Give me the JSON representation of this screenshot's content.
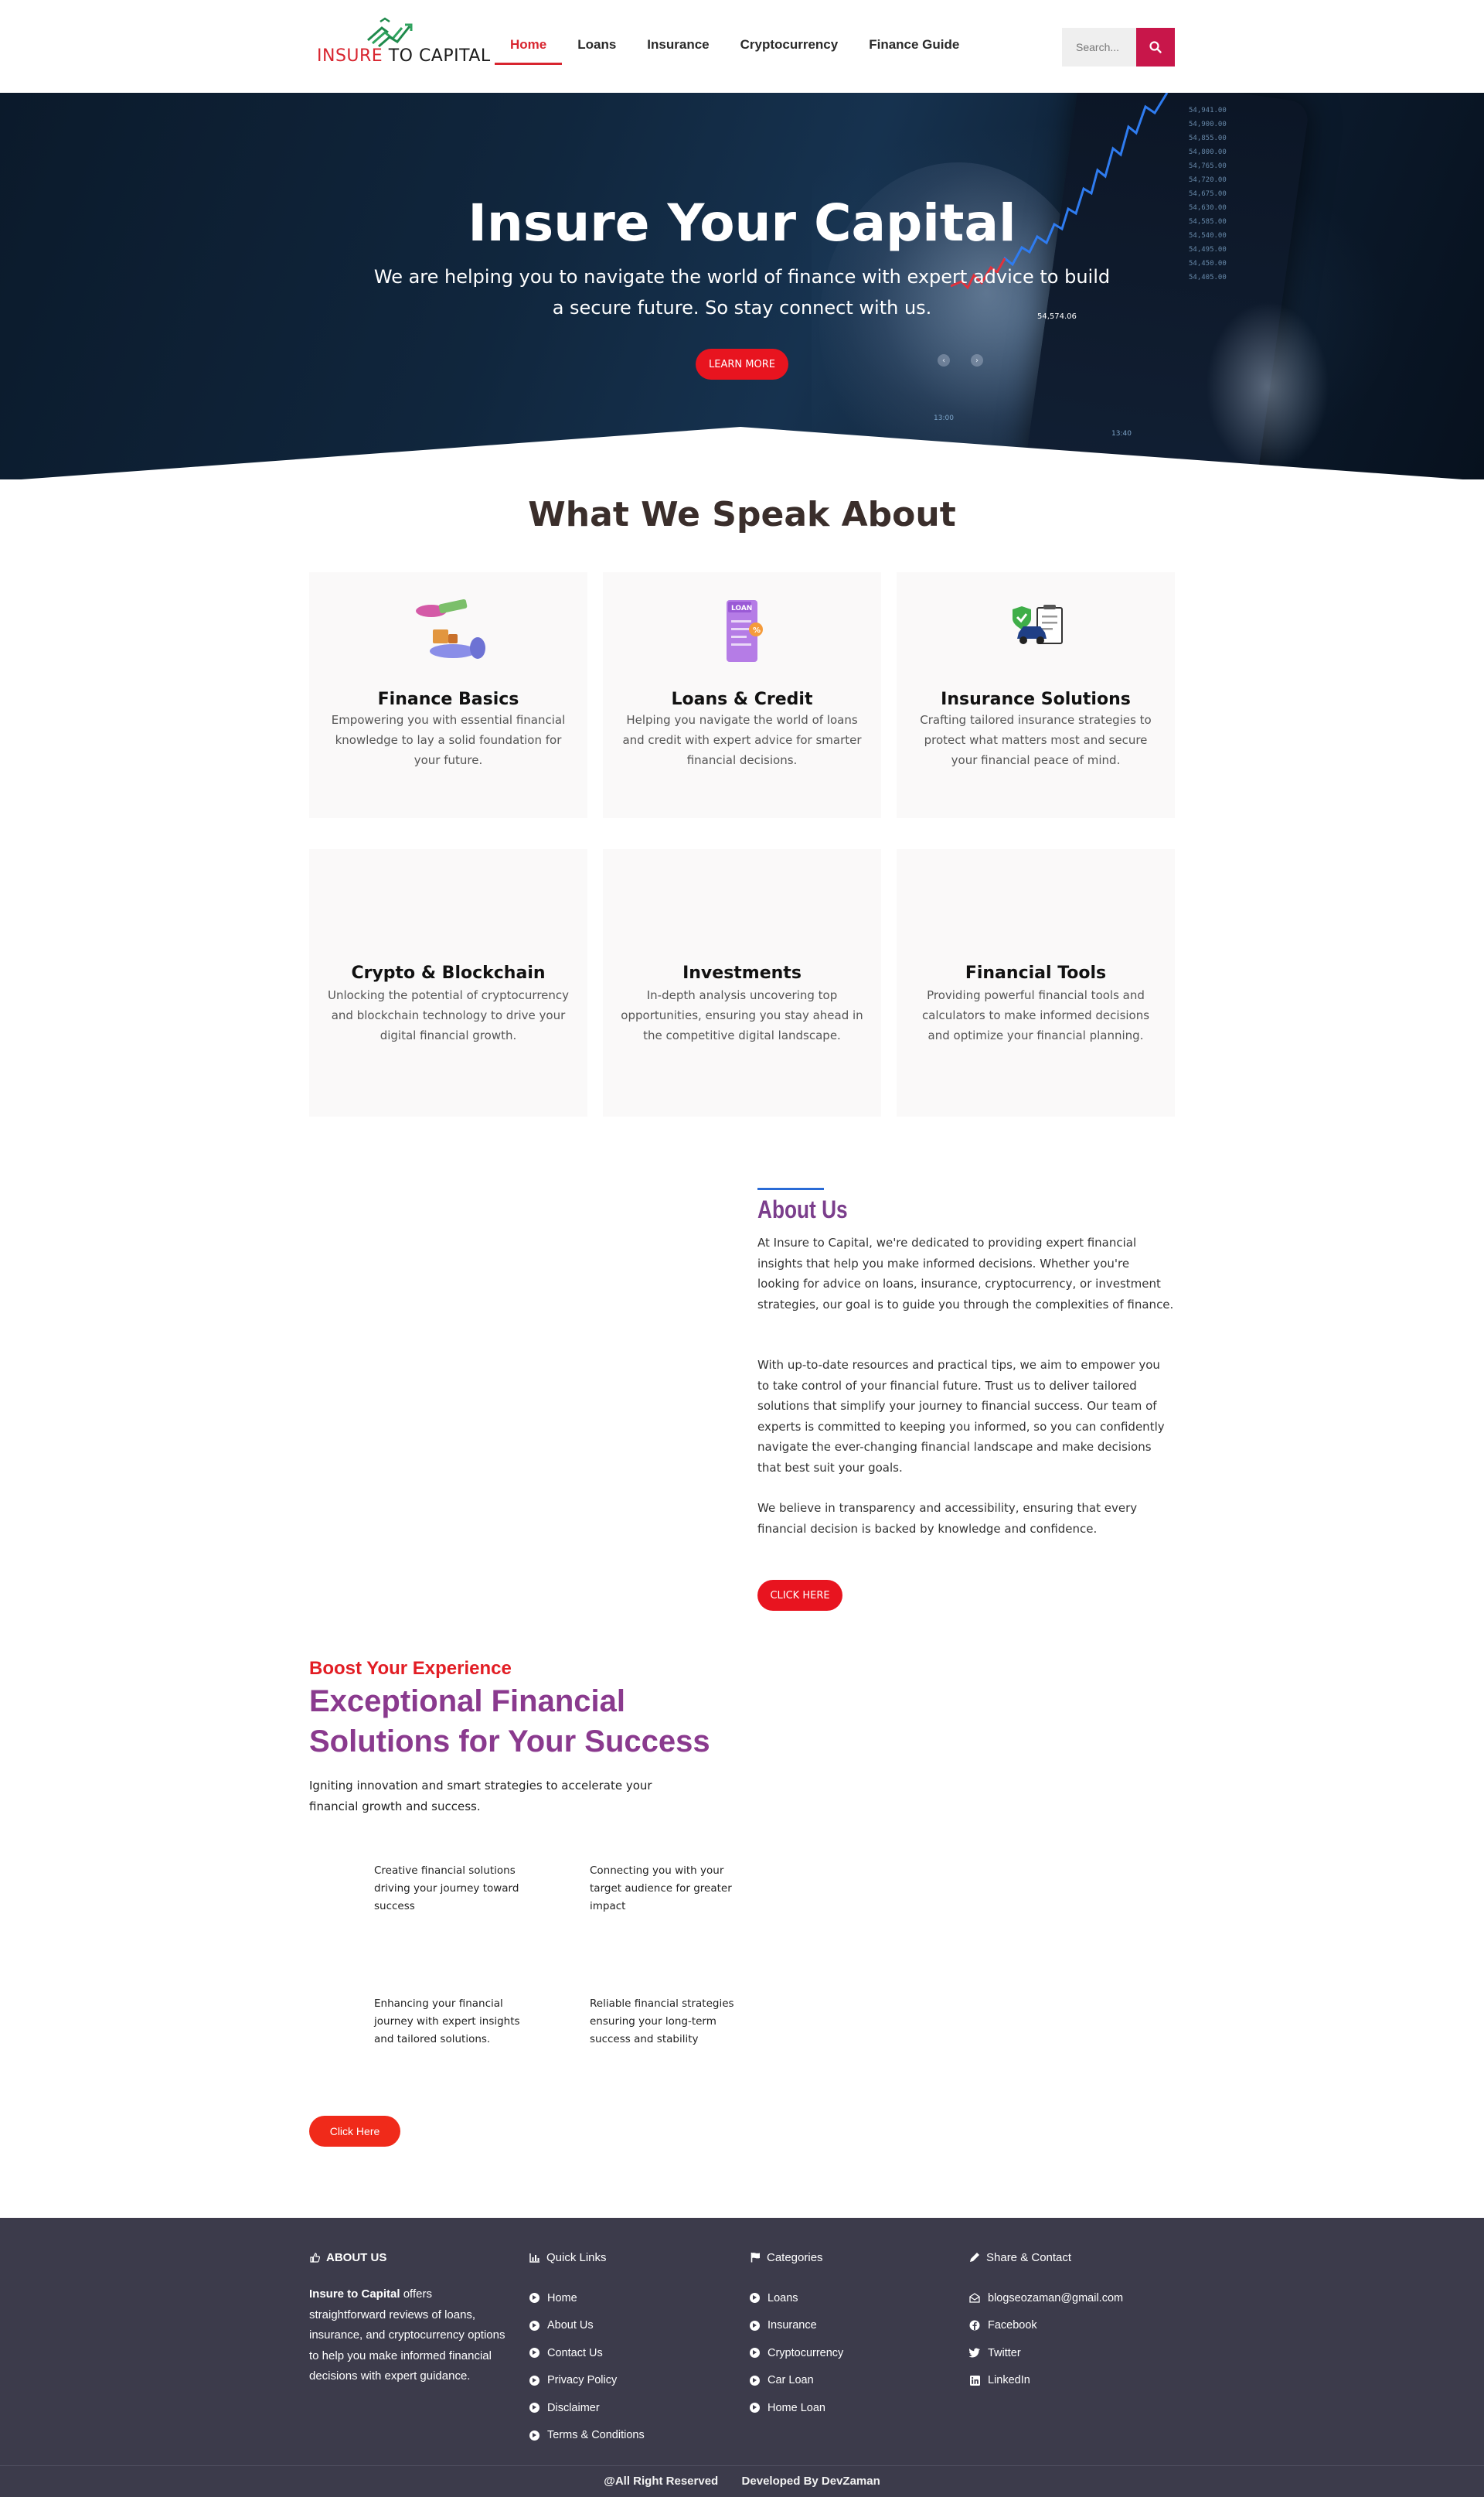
{
  "header": {
    "logo_part1": "INSURE",
    "logo_part2": " TO CAPITAL",
    "nav": [
      "Home",
      "Loans",
      "Insurance",
      "Cryptocurrency",
      "Finance Guide"
    ],
    "search_placeholder": "Search..."
  },
  "hero": {
    "title": "Insure Your Capital",
    "subtitle": "We are helping you to navigate the world of finance with expert advice to build a secure future. So stay connect with us.",
    "button": "LEARN MORE",
    "chart_label": "54,574.06",
    "price_ticks": [
      "54,941.00",
      "54,900.00",
      "54,855.00",
      "54,800.00",
      "54,765.00",
      "54,720.00",
      "54,675.00",
      "54,630.00",
      "54,585.00",
      "54,540.00",
      "54,495.00",
      "54,450.00",
      "54,405.00"
    ],
    "time_labels": [
      "13:00",
      "13:40"
    ]
  },
  "speak": {
    "title": "What We Speak About",
    "cards": [
      {
        "title": "Finance Basics",
        "desc": "Empowering you with essential financial knowledge to lay a solid foundation for your future."
      },
      {
        "title": "Loans & Credit",
        "desc": "Helping you navigate the world of loans and credit with expert advice for smarter financial decisions."
      },
      {
        "title": "Insurance Solutions",
        "desc": "Crafting tailored insurance strategies to protect what matters most and secure your financial peace of mind."
      },
      {
        "title": "Crypto & Blockchain",
        "desc": "Unlocking the potential of cryptocurrency and blockchain technology to drive your digital financial growth."
      },
      {
        "title": "Investments",
        "desc": "In-depth analysis uncovering top opportunities, ensuring you stay ahead in the competitive digital landscape."
      },
      {
        "title": "Financial Tools",
        "desc": "Providing powerful financial tools and calculators to make informed decisions and optimize your financial planning."
      }
    ],
    "loan_icon_label": "LOAN"
  },
  "about": {
    "title": "About Us",
    "p1": "At Insure to Capital, we're dedicated to providing expert financial insights that help you make informed decisions. Whether you're looking for advice on loans, insurance, cryptocurrency, or investment strategies, our goal is to guide you through the complexities of finance.",
    "p2": "With up-to-date resources and practical tips, we aim to empower you to take control of your financial future. Trust us to deliver tailored solutions that simplify your journey to financial success. Our team of experts is committed to keeping you informed, so you can confidently navigate the ever-changing financial landscape and make decisions that best suit your goals.",
    "p3": "We believe in transparency and accessibility, ensuring that every financial decision is backed by knowledge and confidence.",
    "button": "CLICK HERE"
  },
  "boost": {
    "kicker": "Boost Your Experience",
    "title": "Exceptional Financial Solutions for Your Success",
    "subtitle": "Igniting innovation and smart strategies to accelerate your financial growth and success.",
    "features": [
      "Creative financial solutions driving your journey toward success",
      "Connecting you with your target audience for greater impact",
      "Enhancing your financial journey with expert insights and tailored solutions.",
      "Reliable financial strategies ensuring your long-term success and stability"
    ],
    "button": "Click Here"
  },
  "footer": {
    "about_head": "ABOUT US",
    "about_brand": "Insure to Capital",
    "about_text": " offers straightforward reviews of loans, insurance, and cryptocurrency options to help you make informed financial decisions with expert guidance.",
    "quick_head": "Quick Links",
    "quick_links": [
      "Home",
      "About Us",
      "Contact Us",
      "Privacy Policy",
      "Disclaimer",
      "Terms & Conditions"
    ],
    "cat_head": "Categories",
    "categories": [
      "Loans",
      "Insurance",
      "Cryptocurrency",
      "Car Loan",
      "Home Loan"
    ],
    "contact_head": "Share & Contact",
    "contacts": [
      "blogseozaman@gmail.com",
      "Facebook",
      "Twitter",
      "LinkedIn"
    ],
    "bottom_left": "@All Right Reserved",
    "bottom_right": "Developed By DevZaman"
  },
  "colors": {
    "accent_red": "#e8141f",
    "search_button": "#c8164a",
    "heading_purple": "#8a3a8e",
    "footer_bg": "#3c3b4b"
  }
}
